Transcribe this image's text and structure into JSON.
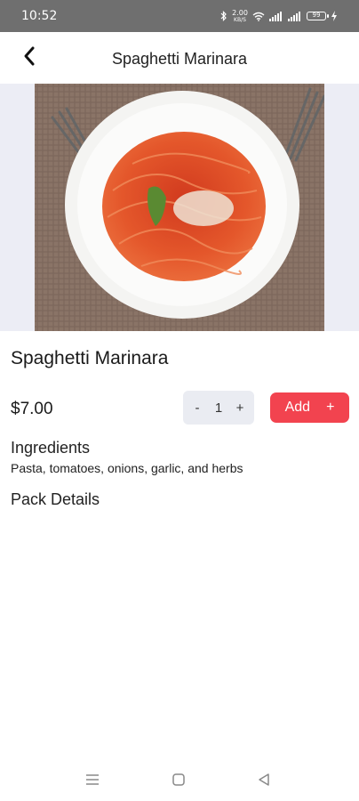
{
  "status_bar": {
    "time": "10:52",
    "network_speed_value": "2.00",
    "network_speed_unit": "KB/S",
    "battery_level": "99"
  },
  "header": {
    "title": "Spaghetti Marinara"
  },
  "product": {
    "name": "Spaghetti Marinara",
    "price": "$7.00",
    "quantity": "1",
    "decrement_label": "-",
    "increment_label": "+",
    "add_label": "Add",
    "add_plus": "+",
    "ingredients_title": "Ingredients",
    "ingredients": "Pasta, tomatoes, onions, garlic, and herbs",
    "pack_details_title": "Pack Details"
  },
  "icons": {
    "back": "back-chevron-icon",
    "bluetooth": "bluetooth-icon",
    "wifi": "wifi-icon",
    "signal": "signal-icon",
    "battery": "battery-icon",
    "charging": "lightning-icon",
    "nav_menu": "menu-icon",
    "nav_home": "square-home-icon",
    "nav_back": "triangle-back-icon"
  },
  "colors": {
    "status_bar": "#6f6f6f",
    "accent": "#f2434f",
    "stepper_bg": "#eaecf2",
    "hero_bg": "#ecedf5"
  }
}
